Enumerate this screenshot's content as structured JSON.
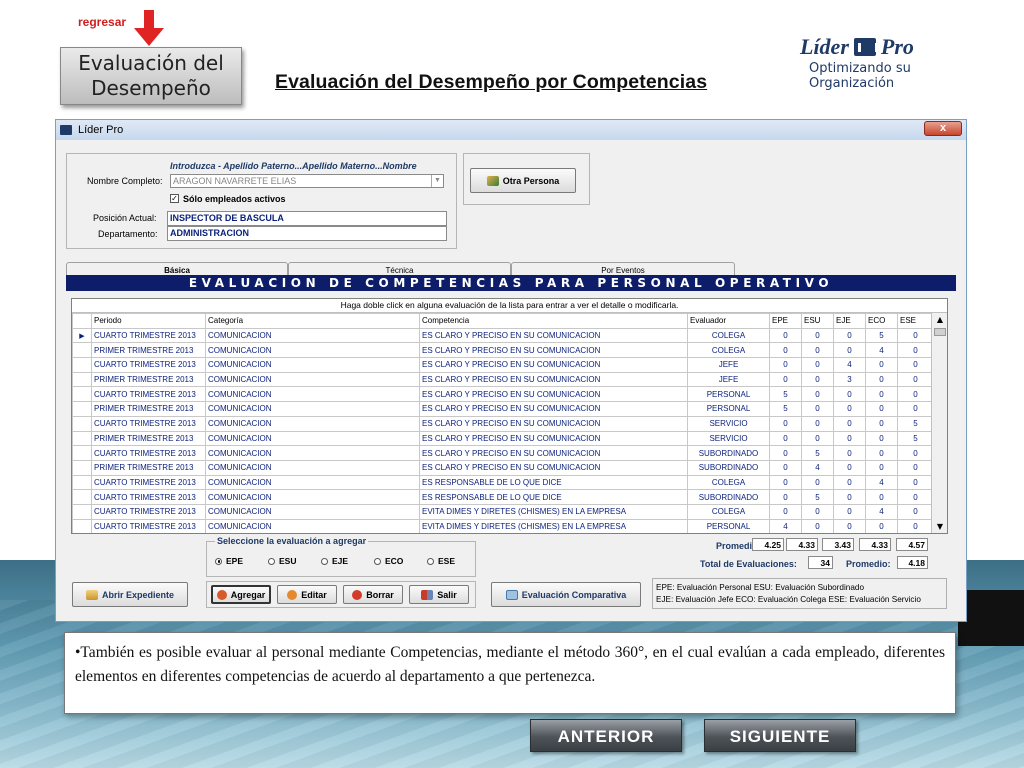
{
  "header": {
    "back_link": "regresar",
    "section_box": "Evaluación del Desempeño",
    "main_title": "Evaluación del Desempeño por Competencias"
  },
  "logo": {
    "name_left": "Líder",
    "name_right": "Pro",
    "tagline": "Optimizando su Organización"
  },
  "window": {
    "title": "Líder Pro",
    "close": "x",
    "search": {
      "hint": "Introduzca - Apellido Paterno...Apellido Materno...Nombre",
      "name_label": "Nombre Completo:",
      "name_value": "ARAGON NAVARRETE ELIAS",
      "only_active_label": "Sólo empleados activos",
      "only_active_checked": true,
      "position_label": "Posición Actual:",
      "position_value": "INSPECTOR DE BASCULA",
      "department_label": "Departamento:",
      "department_value": "ADMINISTRACION",
      "other_person_button": "Otra Persona"
    },
    "tabs": [
      "Básica",
      "Técnica",
      "Por Eventos"
    ],
    "banner": "EVALUACION DE COMPETENCIAS PARA PERSONAL OPERATIVO",
    "grid_hint": "Haga doble click en alguna evaluación de la lista para entrar a ver el detalle o modificarla.",
    "columns": [
      "Periodo",
      "Categoría",
      "Competencia",
      "Evaluador",
      "EPE",
      "ESU",
      "EJE",
      "ECO",
      "ESE"
    ],
    "rows": [
      [
        "CUARTO TRIMESTRE 2013",
        "COMUNICACION",
        "ES CLARO Y PRECISO EN SU COMUNICACION",
        "COLEGA",
        "0",
        "0",
        "0",
        "5",
        "0"
      ],
      [
        "PRIMER TRIMESTRE 2013",
        "COMUNICACION",
        "ES CLARO Y PRECISO EN SU COMUNICACION",
        "COLEGA",
        "0",
        "0",
        "0",
        "4",
        "0"
      ],
      [
        "CUARTO TRIMESTRE 2013",
        "COMUNICACION",
        "ES CLARO Y PRECISO EN SU COMUNICACION",
        "JEFE",
        "0",
        "0",
        "4",
        "0",
        "0"
      ],
      [
        "PRIMER TRIMESTRE 2013",
        "COMUNICACION",
        "ES CLARO Y PRECISO EN SU COMUNICACION",
        "JEFE",
        "0",
        "0",
        "3",
        "0",
        "0"
      ],
      [
        "CUARTO TRIMESTRE 2013",
        "COMUNICACION",
        "ES CLARO Y PRECISO EN SU COMUNICACION",
        "PERSONAL",
        "5",
        "0",
        "0",
        "0",
        "0"
      ],
      [
        "PRIMER TRIMESTRE 2013",
        "COMUNICACION",
        "ES CLARO Y PRECISO EN SU COMUNICACION",
        "PERSONAL",
        "5",
        "0",
        "0",
        "0",
        "0"
      ],
      [
        "CUARTO TRIMESTRE 2013",
        "COMUNICACION",
        "ES CLARO Y PRECISO EN SU COMUNICACION",
        "SERVICIO",
        "0",
        "0",
        "0",
        "0",
        "5"
      ],
      [
        "PRIMER TRIMESTRE 2013",
        "COMUNICACION",
        "ES CLARO Y PRECISO EN SU COMUNICACION",
        "SERVICIO",
        "0",
        "0",
        "0",
        "0",
        "5"
      ],
      [
        "CUARTO TRIMESTRE 2013",
        "COMUNICACION",
        "ES CLARO Y PRECISO EN SU COMUNICACION",
        "SUBORDINADO",
        "0",
        "5",
        "0",
        "0",
        "0"
      ],
      [
        "PRIMER TRIMESTRE 2013",
        "COMUNICACION",
        "ES CLARO Y PRECISO EN SU COMUNICACION",
        "SUBORDINADO",
        "0",
        "4",
        "0",
        "0",
        "0"
      ],
      [
        "CUARTO TRIMESTRE 2013",
        "COMUNICACION",
        "ES RESPONSABLE DE LO QUE DICE",
        "COLEGA",
        "0",
        "0",
        "0",
        "4",
        "0"
      ],
      [
        "CUARTO TRIMESTRE 2013",
        "COMUNICACION",
        "ES RESPONSABLE DE LO QUE DICE",
        "SUBORDINADO",
        "0",
        "5",
        "0",
        "0",
        "0"
      ],
      [
        "CUARTO TRIMESTRE 2013",
        "COMUNICACION",
        "EVITA DIMES Y DIRETES (CHISMES) EN LA EMPRESA",
        "COLEGA",
        "0",
        "0",
        "0",
        "4",
        "0"
      ],
      [
        "CUARTO TRIMESTRE 2013",
        "COMUNICACION",
        "EVITA DIMES Y DIRETES (CHISMES) EN LA EMPRESA",
        "PERSONAL",
        "4",
        "0",
        "0",
        "0",
        "0"
      ]
    ],
    "select_group": {
      "title": "Seleccione la evaluación a agregar",
      "options": [
        "EPE",
        "ESU",
        "EJE",
        "ECO",
        "ESE"
      ],
      "selected": "EPE"
    },
    "summary": {
      "average_label": "Promedio:",
      "averages": [
        "4.25",
        "4.33",
        "3.43",
        "4.33",
        "4.57"
      ],
      "total_label": "Total de Evaluaciones:",
      "total_value": "34",
      "overall_label": "Promedio:",
      "overall_value": "4.18"
    },
    "buttons": {
      "open_file": "Abrir Expediente",
      "add": "Agregar",
      "edit": "Editar",
      "delete": "Borrar",
      "exit": "Salir",
      "comparative": "Evaluación Comparativa"
    },
    "legend": [
      "EPE: Evaluación Personal ESU: Evaluación Subordinado",
      "EJE: Evaluación Jefe ECO: Evaluación Colega ESE: Evaluación Servicio"
    ]
  },
  "caption": "•También es posible evaluar al personal mediante Competencias, mediante el método 360°, en el cual evalúan a cada empleado, diferentes elementos en diferentes competencias de acuerdo al departamento a que pertenezca.",
  "nav": {
    "prev": "ANTERIOR",
    "next": "SIGUIENTE"
  },
  "colors": {
    "banner": "#0d1d6a",
    "grid_text": "#0a1f7a",
    "back_link": "#d21e1e",
    "logo": "#1f3a66"
  }
}
